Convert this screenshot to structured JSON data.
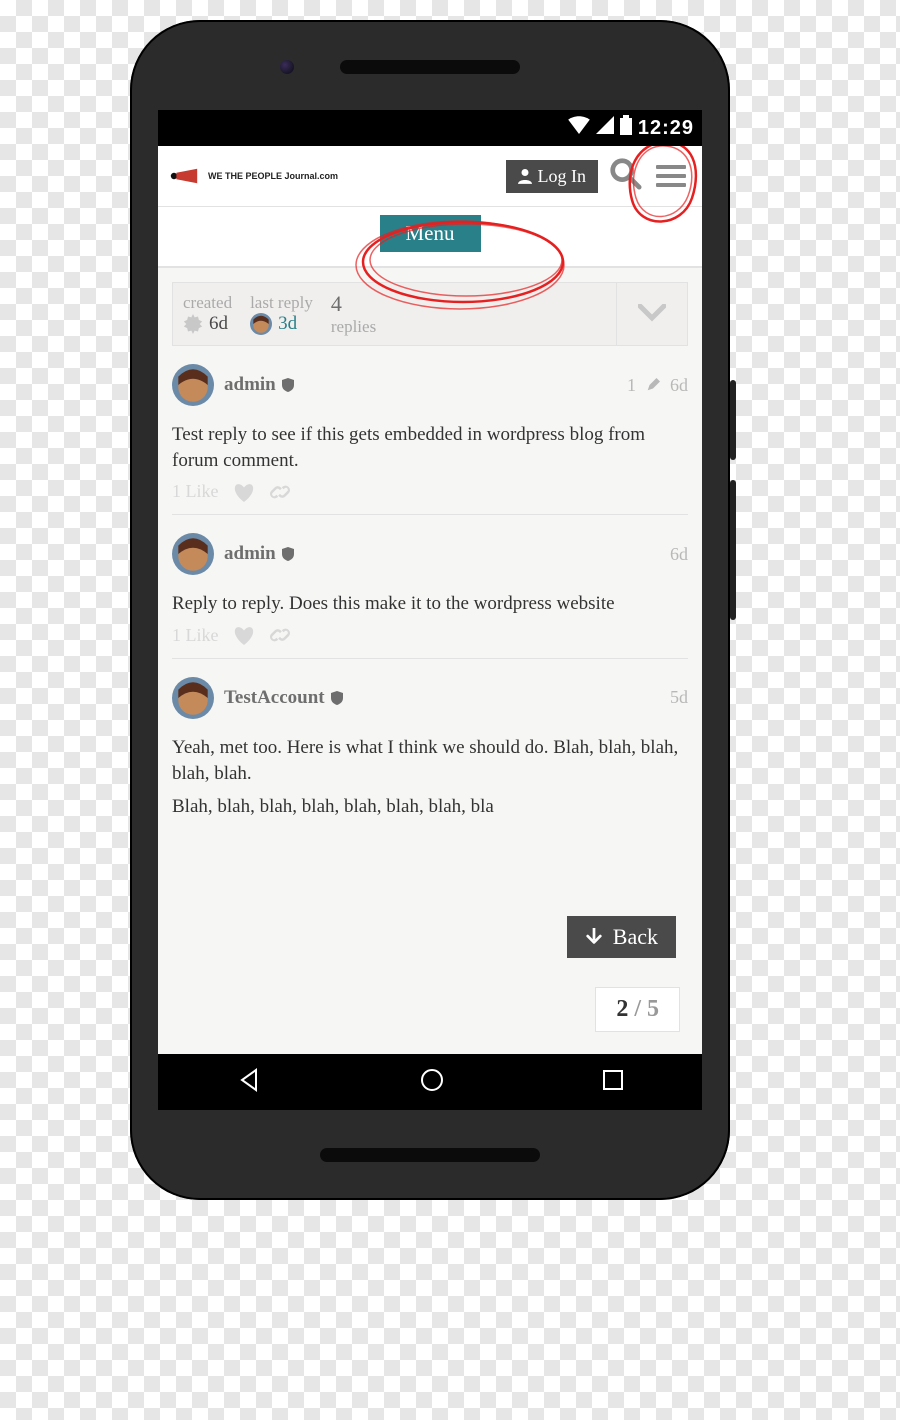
{
  "status": {
    "clock": "12:29"
  },
  "header": {
    "logo_text": "WE THE PEOPLE Journal.com",
    "login_label": "Log In",
    "menu_label": "Menu"
  },
  "summary": {
    "created_label": "created",
    "created_value": "6d",
    "last_reply_label": "last reply",
    "last_reply_value": "3d",
    "replies_count": "4",
    "replies_label": "replies"
  },
  "posts": [
    {
      "author": "admin",
      "age": "6d",
      "edits": "1",
      "body": "Test reply to see if this gets embedded in wordpress blog from forum comment.",
      "likes": "1 Like"
    },
    {
      "author": "admin",
      "age": "6d",
      "body": "Reply to reply. Does this make it to the wordpress website",
      "likes": "1 Like"
    },
    {
      "author": "TestAccount",
      "age": "5d",
      "body": "Yeah, met too. Here is what I think we should do. Blah, blah, blah, blah, blah.",
      "body2": "Blah, blah, blah, blah, blah, blah, blah, bla"
    }
  ],
  "back_label": "Back",
  "pager": {
    "current": "2",
    "sep": " / ",
    "total": "5"
  }
}
